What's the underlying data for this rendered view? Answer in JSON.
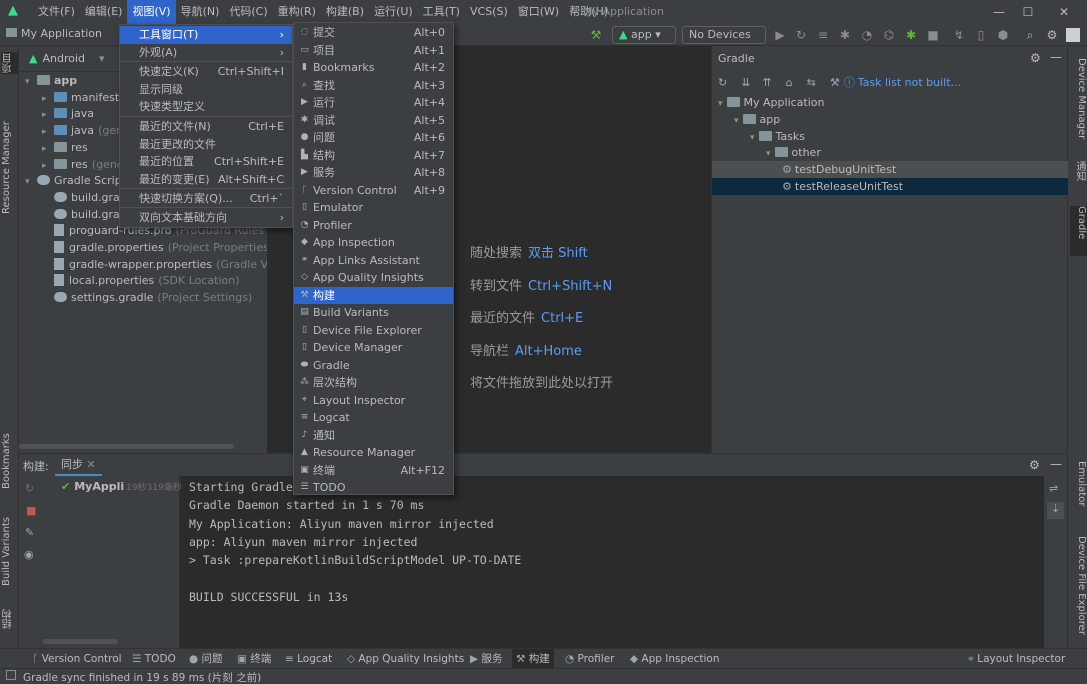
{
  "menubar": {
    "items": [
      "文件(F)",
      "编辑(E)",
      "视图(V)",
      "导航(N)",
      "代码(C)",
      "重构(R)",
      "构建(B)",
      "运行(U)",
      "工具(T)",
      "VCS(S)",
      "窗口(W)",
      "帮助(H)"
    ],
    "active_index": 2
  },
  "window": {
    "title": "My Application"
  },
  "toolbar": {
    "project_crumb": "My Application",
    "run_config": "app",
    "device": "No Devices"
  },
  "left_strip": {
    "tabs": [
      "项目",
      "Resource Manager",
      "Bookmarks",
      "Build Variants",
      "结构"
    ]
  },
  "right_strip": {
    "tabs": [
      "Device Manager",
      "通知",
      "Gradle",
      "Emulator",
      "Device File Explorer"
    ]
  },
  "project": {
    "view_selector": "Android",
    "tree": [
      {
        "label": "app",
        "note": "",
        "depth": 0,
        "kind": "folder",
        "expanded": true
      },
      {
        "label": "manifests",
        "note": "",
        "depth": 1,
        "kind": "folder-blue",
        "expanded": false
      },
      {
        "label": "java",
        "note": "",
        "depth": 1,
        "kind": "folder-blue",
        "expanded": false
      },
      {
        "label": "java",
        "note": "(gene",
        "depth": 1,
        "kind": "folder-blue",
        "expanded": false
      },
      {
        "label": "res",
        "note": "",
        "depth": 1,
        "kind": "folder",
        "expanded": false
      },
      {
        "label": "res",
        "note": "(gener",
        "depth": 1,
        "kind": "folder",
        "expanded": false
      },
      {
        "label": "Gradle Script",
        "note": "",
        "depth": 0,
        "kind": "gradle",
        "expanded": true
      },
      {
        "label": "build.grad",
        "note": "",
        "depth": 1,
        "kind": "gradle",
        "expanded": null
      },
      {
        "label": "build.grad",
        "note": "",
        "depth": 1,
        "kind": "gradle",
        "expanded": null
      },
      {
        "label": "proguard-rules.pro",
        "note": "(ProGuard Rules for",
        "depth": 1,
        "kind": "file",
        "expanded": null
      },
      {
        "label": "gradle.properties",
        "note": "(Project Properties)",
        "depth": 1,
        "kind": "file",
        "expanded": null
      },
      {
        "label": "gradle-wrapper.properties",
        "note": "(Gradle Versi",
        "depth": 1,
        "kind": "file",
        "expanded": null
      },
      {
        "label": "local.properties",
        "note": "(SDK Location)",
        "depth": 1,
        "kind": "file",
        "expanded": null
      },
      {
        "label": "settings.gradle",
        "note": "(Project Settings)",
        "depth": 1,
        "kind": "gradle",
        "expanded": null
      }
    ]
  },
  "editor_hints": [
    {
      "text": "随处搜索",
      "key": "双击 Shift"
    },
    {
      "text": "转到文件",
      "key": "Ctrl+Shift+N"
    },
    {
      "text": "最近的文件",
      "key": "Ctrl+E"
    },
    {
      "text": "导航栏",
      "key": "Alt+Home"
    },
    {
      "text": "将文件拖放到此处以打开",
      "key": ""
    }
  ],
  "gradle": {
    "title": "Gradle",
    "status_link": "Task list not built...",
    "tree": [
      "My Application",
      "app",
      "Tasks",
      "other",
      "testDebugUnitTest",
      "testReleaseUnitTest"
    ]
  },
  "build": {
    "title": "构建:",
    "tab": "同步",
    "tree_item": "MyAppli",
    "tree_time": "19秒319毫秒",
    "console": [
      "Starting Gradle",
      "Gradle Daemon started in 1 s 70 ms",
      "My Application: Aliyun maven mirror injected",
      "app: Aliyun maven mirror injected",
      "> Task :prepareKotlinBuildScriptModel UP-TO-DATE",
      "",
      "BUILD SUCCESSFUL in 13s"
    ]
  },
  "bottom_bar": {
    "items": [
      "Version Control",
      "TODO",
      "问题",
      "终端",
      "Logcat",
      "App Quality Insights",
      "服务",
      "构建",
      "Profiler",
      "App Inspection"
    ],
    "right_item": "Layout Inspector"
  },
  "status": {
    "text": "Gradle sync finished in 19 s 89 ms (片刻 之前)"
  },
  "view_menu": {
    "items": [
      {
        "label": "工具窗口(T)",
        "shortcut": "",
        "submenu": true
      },
      {
        "label": "外观(A)",
        "shortcut": "",
        "submenu": true
      },
      {
        "label": "快速定义(K)",
        "shortcut": "Ctrl+Shift+I",
        "submenu": false
      },
      {
        "label": "显示同级",
        "shortcut": "",
        "submenu": false
      },
      {
        "label": "快速类型定义",
        "shortcut": "",
        "submenu": false
      },
      {
        "label": "最近的文件(N)",
        "shortcut": "Ctrl+E",
        "submenu": false
      },
      {
        "label": "最近更改的文件",
        "shortcut": "",
        "submenu": false
      },
      {
        "label": "最近的位置",
        "shortcut": "Ctrl+Shift+E",
        "submenu": false
      },
      {
        "label": "最近的变更(E)",
        "shortcut": "Alt+Shift+C",
        "submenu": false
      },
      {
        "label": "快速切换方案(Q)...",
        "shortcut": "Ctrl+`",
        "submenu": false
      },
      {
        "label": "双向文本基础方向",
        "shortcut": "",
        "submenu": true
      }
    ]
  },
  "tool_windows_menu": {
    "items": [
      {
        "label": "提交",
        "shortcut": "Alt+0",
        "icon": "commit-icon"
      },
      {
        "label": "项目",
        "shortcut": "Alt+1",
        "icon": "project-icon"
      },
      {
        "label": "Bookmarks",
        "shortcut": "Alt+2",
        "icon": "bookmark-icon"
      },
      {
        "label": "查找",
        "shortcut": "Alt+3",
        "icon": "find-icon"
      },
      {
        "label": "运行",
        "shortcut": "Alt+4",
        "icon": "run-icon"
      },
      {
        "label": "调试",
        "shortcut": "Alt+5",
        "icon": "debug-icon"
      },
      {
        "label": "问题",
        "shortcut": "Alt+6",
        "icon": "problems-icon"
      },
      {
        "label": "结构",
        "shortcut": "Alt+7",
        "icon": "structure-icon"
      },
      {
        "label": "服务",
        "shortcut": "Alt+8",
        "icon": "services-icon"
      },
      {
        "label": "Version Control",
        "shortcut": "Alt+9",
        "icon": "vcs-icon"
      },
      {
        "label": "Emulator",
        "shortcut": "",
        "icon": "emulator-icon"
      },
      {
        "label": "Profiler",
        "shortcut": "",
        "icon": "profiler-icon"
      },
      {
        "label": "App Inspection",
        "shortcut": "",
        "icon": "inspection-icon"
      },
      {
        "label": "App Links Assistant",
        "shortcut": "",
        "icon": "links-icon"
      },
      {
        "label": "App Quality Insights",
        "shortcut": "",
        "icon": "quality-icon"
      },
      {
        "label": "构建",
        "shortcut": "",
        "icon": "build-icon"
      },
      {
        "label": "Build Variants",
        "shortcut": "",
        "icon": "variants-icon"
      },
      {
        "label": "Device File Explorer",
        "shortcut": "",
        "icon": "file-explorer-icon"
      },
      {
        "label": "Device Manager",
        "shortcut": "",
        "icon": "device-manager-icon"
      },
      {
        "label": "Gradle",
        "shortcut": "",
        "icon": "gradle-icon"
      },
      {
        "label": "层次结构",
        "shortcut": "",
        "icon": "hierarchy-icon"
      },
      {
        "label": "Layout Inspector",
        "shortcut": "",
        "icon": "layout-inspector-icon"
      },
      {
        "label": "Logcat",
        "shortcut": "",
        "icon": "logcat-icon"
      },
      {
        "label": "通知",
        "shortcut": "",
        "icon": "notifications-icon"
      },
      {
        "label": "Resource Manager",
        "shortcut": "",
        "icon": "resource-manager-icon"
      },
      {
        "label": "终端",
        "shortcut": "Alt+F12",
        "icon": "terminal-icon"
      },
      {
        "label": "TODO",
        "shortcut": "",
        "icon": "todo-icon"
      }
    ],
    "highlighted_index": 15
  },
  "colors": {
    "accent": "#2f65ca",
    "link": "#589df6",
    "success": "#5fb832",
    "panel": "#3c3f41",
    "editor": "#2b2b2b"
  }
}
